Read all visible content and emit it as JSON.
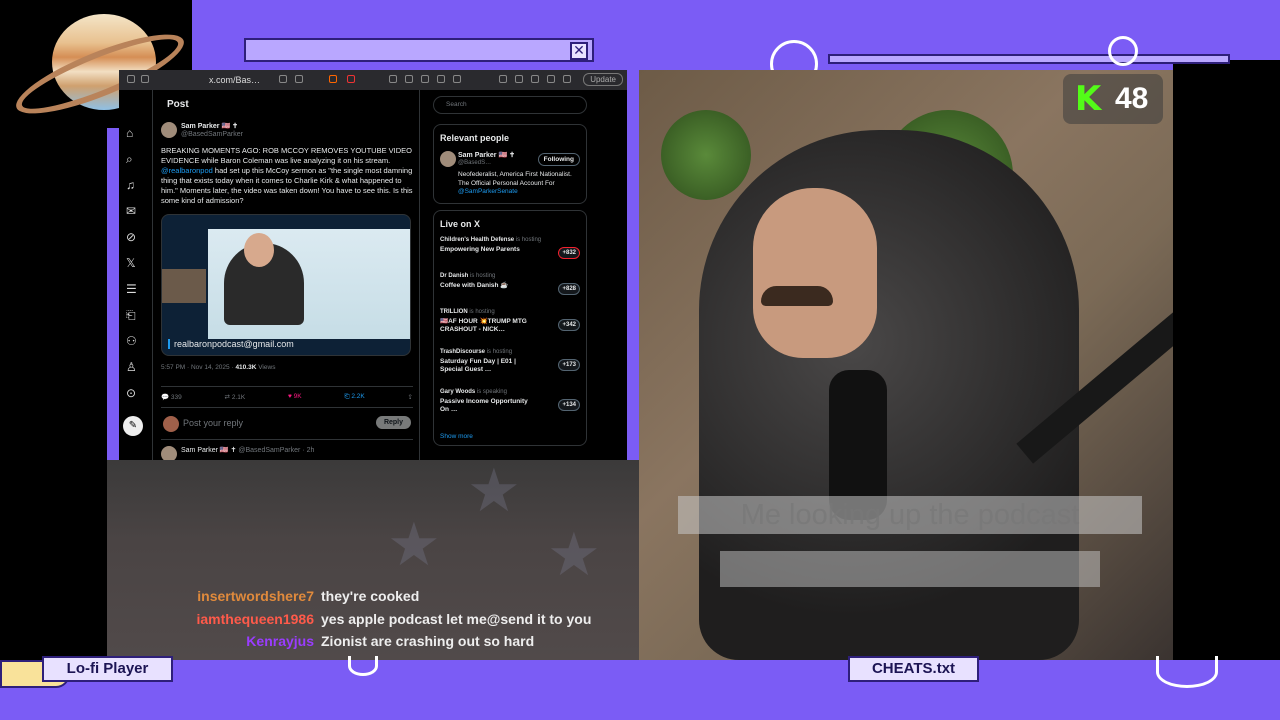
{
  "browser": {
    "url": "x.com/Bas…",
    "update_label": "Update",
    "post_header": "Post",
    "author": {
      "name": "Sam Parker 🇺🇸 ✝",
      "handle": "@BasedSamParker"
    },
    "tweet": {
      "text_part1": "BREAKING MOMENTS AGO: ROB MCCOY REMOVES YOUTUBE VIDEO EVIDENCE while Baron Coleman was live analyzing it on his stream.",
      "mention": "@realbaronpod",
      "text_part2": "had set up this McCoy sermon as \"the single most damning thing that exists today when it comes to Charlie Kirk & what happened to him.\" Moments later, the video was taken down! You have to see this. Is this some kind of admission?",
      "media_email": "realbaronpodcast@gmail.com",
      "timestamp": "5:57 PM · Nov 14, 2025 ·",
      "views_count": "410.3K",
      "views_label": "Views"
    },
    "stats": {
      "replies": "339",
      "reposts": "2.1K",
      "likes": "9K",
      "bookmarks": "2.2K"
    },
    "reply_placeholder": "Post your reply",
    "reply_button": "Reply",
    "next_reply": {
      "name": "Sam Parker 🇺🇸 ✝",
      "handle": "@BasedSamParker · 2h"
    },
    "search_placeholder": "Search",
    "relevant": {
      "title": "Relevant people",
      "name": "Sam Parker 🇺🇸 ✝",
      "handle": "@BasedS…",
      "follow_label": "Following",
      "bio": "Neofederalist, America First Nationalist. The Official Personal Account For",
      "bio_mention": "@SamParkerSenate"
    },
    "live": {
      "title": "Live on X",
      "items": [
        {
          "host": "Children's Health Defense",
          "status": "is hosting",
          "title": "Empowering New Parents",
          "count": "+832"
        },
        {
          "host": "Dr Danish",
          "status": "is hosting",
          "title": "Coffee with Danish ☕",
          "count": "+828"
        },
        {
          "host": "TRILLION",
          "status": "is hosting",
          "title": "🇺🇸AF HOUR 💥TRUMP MTG CRASHOUT - NICK…",
          "count": "+342"
        },
        {
          "host": "TrashDiscourse",
          "status": "is hosting",
          "title": "Saturday Fun Day | E01 | Special Guest …",
          "count": "+173"
        },
        {
          "host": "Gary Woods",
          "status": "is speaking",
          "title": "Passive Income Opportunity On …",
          "count": "+134"
        }
      ],
      "show_more": "Show more"
    }
  },
  "overlay": {
    "kick_count": "48",
    "caption_line1": "Me looking up the podcast",
    "lofi_label": "Lo-fi Player",
    "cheats_label": "CHEATS.txt"
  },
  "chat": [
    {
      "user": "insertwordshere7",
      "message": "they're cooked",
      "color": "#e08a3c"
    },
    {
      "user": "iamthequeen1986",
      "message": "yes apple podcast let me@send it to you",
      "color": "#ff5a4a"
    },
    {
      "user": "Kenrayjus",
      "message": "Zionist are crashing out so hard",
      "color": "#9a3cff"
    }
  ],
  "colors": {
    "brand_purple": "#7b5cf5",
    "kick_green": "#53fc18",
    "x_blue": "#1d9bf0",
    "like_pink": "#f91880"
  }
}
